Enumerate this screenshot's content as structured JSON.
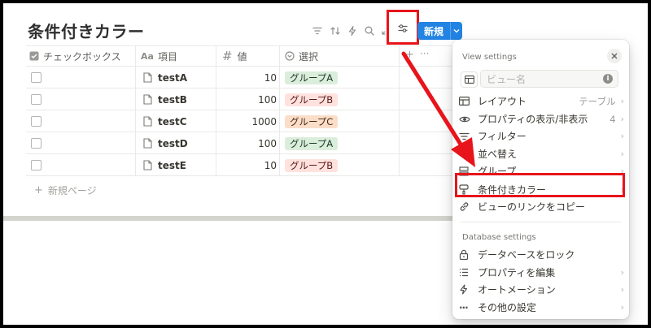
{
  "page": {
    "title": "条件付きカラー"
  },
  "toolbar": {
    "new_label": "新規"
  },
  "table": {
    "columns": [
      {
        "icon": "checkbox-icon",
        "label": "チェックボックス"
      },
      {
        "icon": "text-icon",
        "glyph": "Aa",
        "label": "項目"
      },
      {
        "icon": "hash-icon",
        "glyph": "#",
        "label": "値"
      },
      {
        "icon": "select-icon",
        "label": "選択"
      }
    ],
    "add_column": "+",
    "more": "···",
    "rows": [
      {
        "title": "testA",
        "value": "10",
        "group": "グループA",
        "group_color": "#dbeddb",
        "group_text": "#1c3829"
      },
      {
        "title": "testB",
        "value": "100",
        "group": "グループB",
        "group_color": "#ffe2dd",
        "group_text": "#5d1715"
      },
      {
        "title": "testC",
        "value": "1000",
        "group": "グループC",
        "group_color": "#fadec9",
        "group_text": "#49290e"
      },
      {
        "title": "testD",
        "value": "100",
        "group": "グループA",
        "group_color": "#dbeddb",
        "group_text": "#1c3829"
      },
      {
        "title": "testE",
        "value": "10",
        "group": "グループB",
        "group_color": "#ffe2dd",
        "group_text": "#5d1715"
      }
    ],
    "new_page": "新規ページ"
  },
  "menu": {
    "view_settings_title": "View settings",
    "view_name_placeholder": "ビュー名",
    "items": [
      {
        "label": "レイアウト",
        "value": "テーブル",
        "icon": "table-icon"
      },
      {
        "label": "プロパティの表示/非表示",
        "value": "4",
        "icon": "eye-icon"
      },
      {
        "label": "フィルター",
        "value": "",
        "icon": "filter-icon"
      },
      {
        "label": "並べ替え",
        "value": "",
        "icon": "sort-icon"
      },
      {
        "label": "グループ",
        "value": "",
        "icon": "group-icon"
      },
      {
        "label": "条件付きカラー",
        "value": "",
        "icon": "paint-icon"
      },
      {
        "label": "ビューのリンクをコピー",
        "value": "",
        "icon": "link-icon"
      }
    ],
    "database_settings_title": "Database settings",
    "db_items": [
      {
        "label": "データベースをロック",
        "icon": "lock-icon"
      },
      {
        "label": "プロパティを編集",
        "icon": "list-icon"
      },
      {
        "label": "オートメーション",
        "icon": "bolt-icon"
      },
      {
        "label": "その他の設定",
        "icon": "more-icon"
      }
    ]
  },
  "colors": {
    "highlight_red": "#e8141b",
    "accent_blue": "#2383e2"
  }
}
